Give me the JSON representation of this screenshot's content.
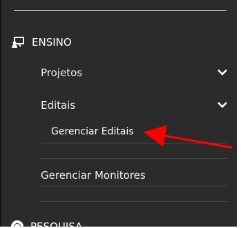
{
  "sidebar": {
    "section_title": "ENSINO",
    "section_icon": "teaching-board-icon",
    "items": [
      {
        "label": "Projetos",
        "has_dropdown": true
      },
      {
        "label": "Editais",
        "has_dropdown": true,
        "subitems": [
          {
            "label": "Gerenciar Editais"
          }
        ]
      },
      {
        "label": "Gerenciar Monitores",
        "has_dropdown": false
      }
    ],
    "next_section_title": "PESQUISA",
    "next_section_icon": "globe-icon"
  },
  "annotation": {
    "pointer_color": "#ff0000"
  }
}
